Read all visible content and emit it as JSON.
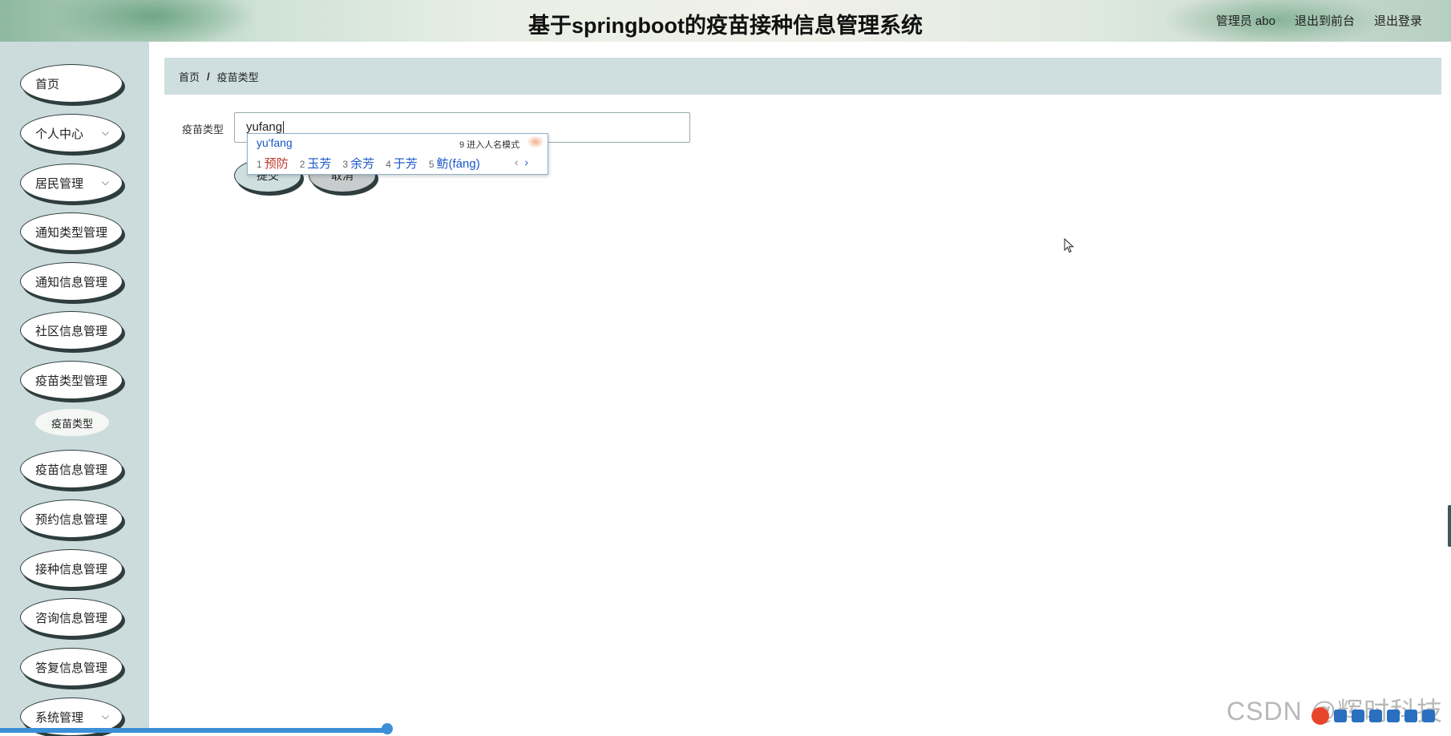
{
  "header": {
    "title": "基于springboot的疫苗接种信息管理系统",
    "user": "管理员 abo",
    "to_front": "退出到前台",
    "logout": "退出登录"
  },
  "sidebar": {
    "items": [
      {
        "label": "首页",
        "expandable": false
      },
      {
        "label": "个人中心",
        "expandable": true
      },
      {
        "label": "居民管理",
        "expandable": true
      },
      {
        "label": "通知类型管理",
        "expandable": false
      },
      {
        "label": "通知信息管理",
        "expandable": false
      },
      {
        "label": "社区信息管理",
        "expandable": false
      },
      {
        "label": "疫苗类型管理",
        "expandable": false
      },
      {
        "label": "疫苗信息管理",
        "expandable": false
      },
      {
        "label": "预约信息管理",
        "expandable": false
      },
      {
        "label": "接种信息管理",
        "expandable": false
      },
      {
        "label": "咨询信息管理",
        "expandable": false
      },
      {
        "label": "答复信息管理",
        "expandable": false
      },
      {
        "label": "系统管理",
        "expandable": true
      }
    ],
    "sub_item": "疫苗类型"
  },
  "breadcrumb": {
    "home": "首页",
    "separator": "/",
    "current": "疫苗类型"
  },
  "form": {
    "label": "疫苗类型",
    "value": "yufang",
    "submit": "提交",
    "cancel": "取消"
  },
  "ime": {
    "pinyin": "yu'fang",
    "hint": "9 进入人名模式",
    "candidates": [
      {
        "num": "1",
        "text": "预防"
      },
      {
        "num": "2",
        "text": "玉芳"
      },
      {
        "num": "3",
        "text": "余芳"
      },
      {
        "num": "4",
        "text": "于芳"
      },
      {
        "num": "5",
        "text": "鲂(fáng)"
      }
    ],
    "prev": "‹",
    "next": "›"
  },
  "watermark": "CSDN @辉时科技",
  "colors": {
    "sidebar_bg": "#ccdcdc",
    "breadcrumb_bg": "#cfdfe0",
    "ime_text": "#1a56c8",
    "ime_first": "#c0392b"
  }
}
